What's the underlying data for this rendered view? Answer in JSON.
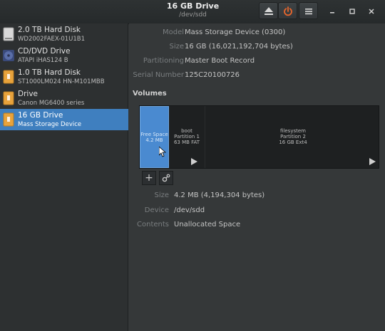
{
  "window": {
    "title": "16 GB Drive",
    "subtitle": "/dev/sdd"
  },
  "sidebar": {
    "items": [
      {
        "name": "2.0 TB Hard Disk",
        "model": "WD2002FAEX-01U1B1",
        "icon": "hard-disk-icon",
        "selected": false
      },
      {
        "name": "CD/DVD Drive",
        "model": "ATAPI   iHAS124   B",
        "icon": "optical-drive-icon",
        "selected": false
      },
      {
        "name": "1.0 TB Hard Disk",
        "model": "ST1000LM024 HN-M101MBB",
        "icon": "usb-drive-icon",
        "selected": false
      },
      {
        "name": "Drive",
        "model": "Canon MG6400 series",
        "icon": "usb-drive-icon",
        "selected": false
      },
      {
        "name": "16 GB Drive",
        "model": "Mass Storage Device",
        "icon": "usb-drive-icon",
        "selected": true
      }
    ]
  },
  "drive_info": {
    "model_label": "Model",
    "model_value": "Mass Storage Device (0300)",
    "size_label": "Size",
    "size_value": "16 GB (16,021,192,704 bytes)",
    "partitioning_label": "Partitioning",
    "partitioning_value": "Master Boot Record",
    "serial_label": "Serial Number",
    "serial_value": "125C20100726"
  },
  "volumes": {
    "heading": "Volumes",
    "segments": [
      {
        "line1": "Free Space",
        "line2": "4.2 MB",
        "line3": ""
      },
      {
        "line1": "boot",
        "line2": "Partition 1",
        "line3": "63 MB FAT"
      },
      {
        "line1": "filesystem",
        "line2": "Partition 2",
        "line3": "16 GB Ext4"
      }
    ],
    "add_label": "+"
  },
  "volume_info": {
    "size_label": "Size",
    "size_value": "4.2 MB (4,194,304 bytes)",
    "device_label": "Device",
    "device_value": "/dev/sdd",
    "contents_label": "Contents",
    "contents_value": "Unallocated Space"
  },
  "colors": {
    "selection": "#3f7fbf",
    "free_space": "#4a8ad0",
    "power_accent": "#e8662c",
    "usb_drive": "#e8a33c"
  }
}
